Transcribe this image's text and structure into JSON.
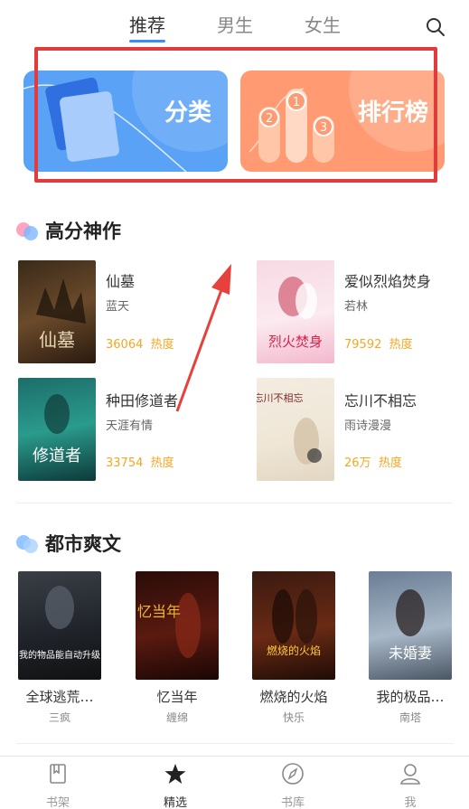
{
  "tabs": [
    {
      "label": "推荐"
    },
    {
      "label": "男生"
    },
    {
      "label": "女生"
    }
  ],
  "banners": {
    "category_label": "分类",
    "ranking_label": "排行榜"
  },
  "section1": {
    "title": "高分神作",
    "books": [
      {
        "title": "仙墓",
        "author": "蓝天",
        "heat": "36064",
        "heat_label": "热度",
        "cover_text": "仙墓"
      },
      {
        "title": "爱似烈焰焚身",
        "author": "若林",
        "heat": "79592",
        "heat_label": "热度",
        "cover_text": "烈火焚身"
      },
      {
        "title": "种田修道者",
        "author": "天涯有情",
        "heat": "33754",
        "heat_label": "热度",
        "cover_text": "修道者"
      },
      {
        "title": "忘川不相忘",
        "author": "雨诗漫漫",
        "heat": "26万",
        "heat_label": "热度",
        "cover_text": "忘川不相忘"
      }
    ]
  },
  "section2": {
    "title": "都市爽文",
    "books": [
      {
        "title": "全球逃荒…",
        "author": "三疯",
        "cover_text": "我的物品能自动升级"
      },
      {
        "title": "忆当年",
        "author": "缠绵",
        "cover_text": "忆当年"
      },
      {
        "title": "燃烧的火焰",
        "author": "快乐",
        "cover_text": "燃烧的火焰"
      },
      {
        "title": "我的极品…",
        "author": "南塔",
        "cover_text": "未婚妻"
      }
    ]
  },
  "bottom_nav": [
    {
      "label": "书架"
    },
    {
      "label": "精选"
    },
    {
      "label": "书库"
    },
    {
      "label": "我"
    }
  ],
  "colors": {
    "accent": "#3a8df6",
    "heat": "#f5a623",
    "highlight_frame": "#e23b3b"
  }
}
